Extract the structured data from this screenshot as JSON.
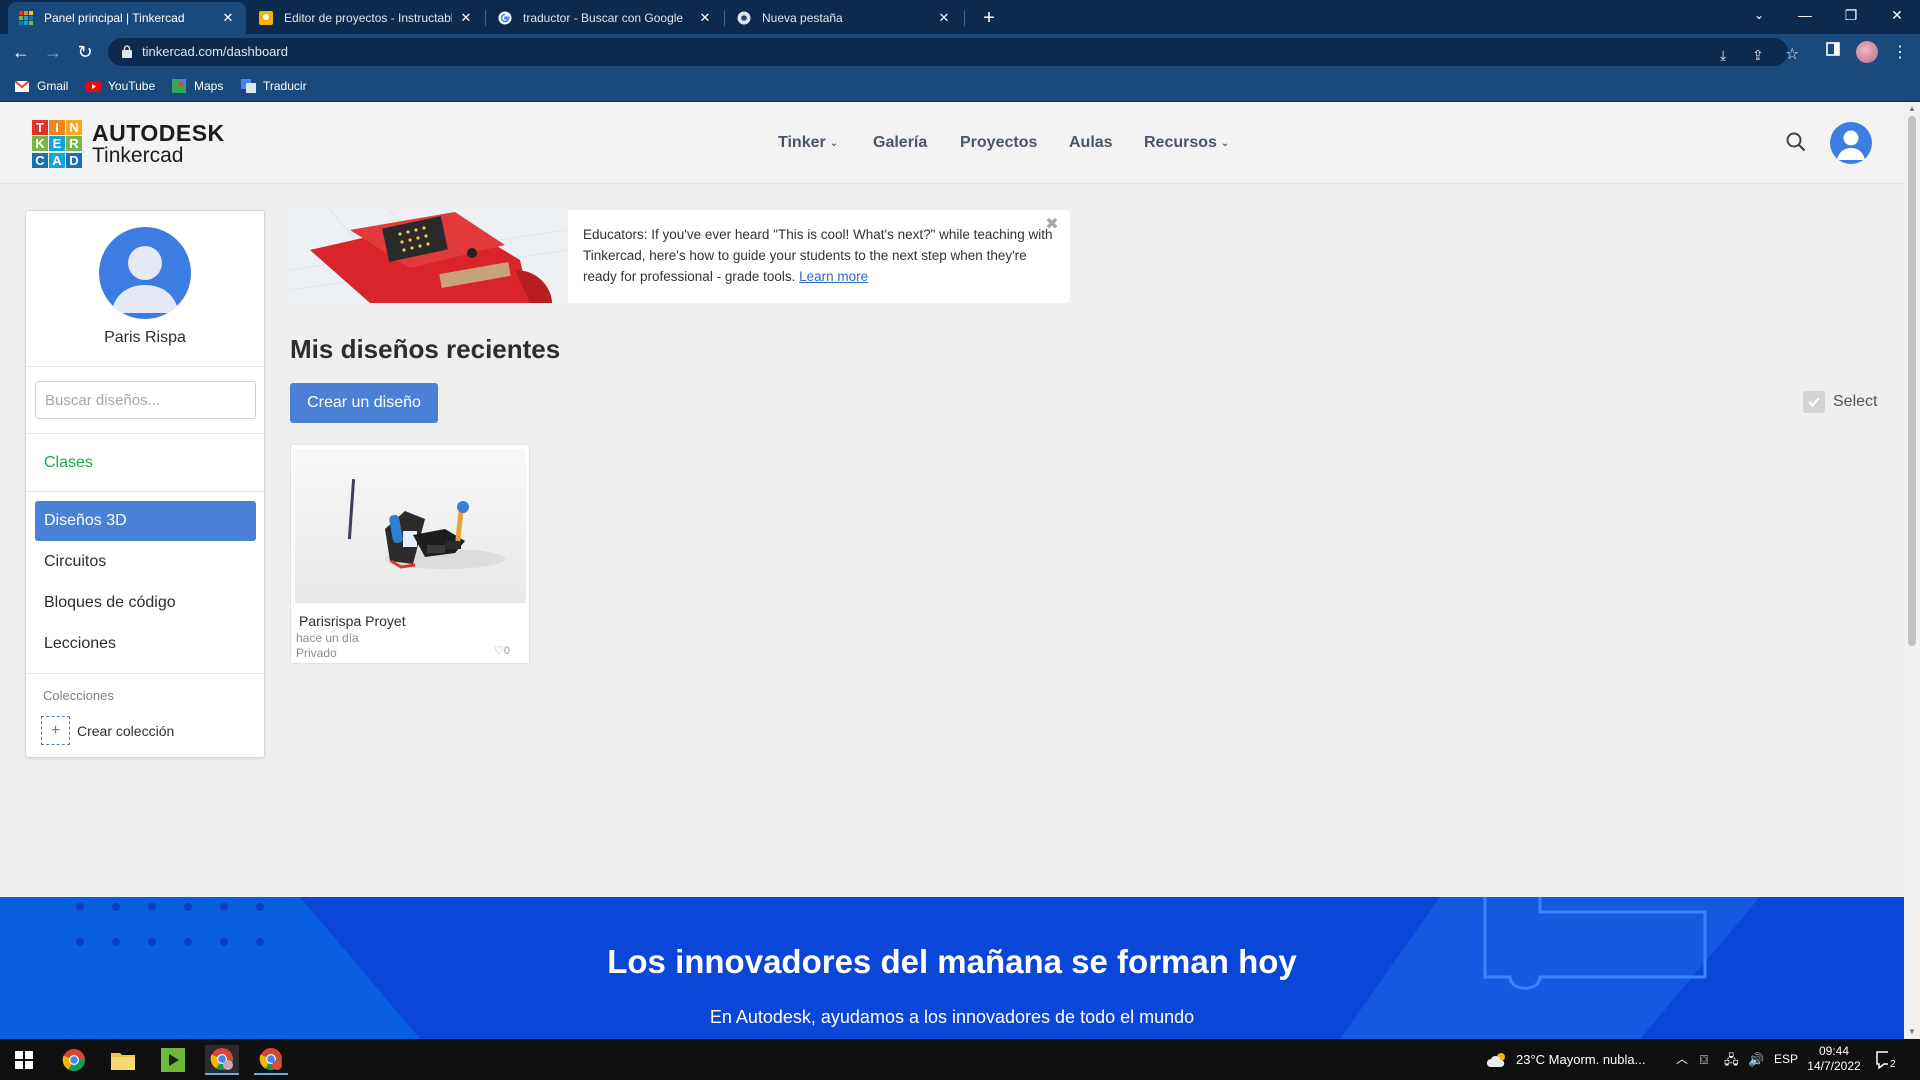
{
  "browser": {
    "tabs": [
      {
        "title": "Panel principal | Tinkercad",
        "active": true,
        "icon": "tinkercad-favicon"
      },
      {
        "title": "Editor de proyectos - Instructables",
        "active": false,
        "icon": "instructables-favicon"
      },
      {
        "title": "traductor - Buscar con Google",
        "active": false,
        "icon": "google-favicon"
      },
      {
        "title": "Nueva pestaña",
        "active": false,
        "icon": "chrome-favicon"
      }
    ],
    "url": "tinkercad.com/dashboard",
    "bookmarks": [
      {
        "label": "Gmail",
        "icon": "gmail-icon"
      },
      {
        "label": "YouTube",
        "icon": "youtube-icon"
      },
      {
        "label": "Maps",
        "icon": "maps-icon"
      },
      {
        "label": "Traducir",
        "icon": "translate-icon"
      }
    ]
  },
  "header": {
    "brand_line1": "AUTODESK",
    "brand_line2": "Tinkercad",
    "logo_letters": [
      "T",
      "I",
      "N",
      "K",
      "E",
      "R",
      "C",
      "A",
      "D"
    ],
    "nav": [
      {
        "label": "Tinker",
        "dropdown": true
      },
      {
        "label": "Galería",
        "dropdown": false
      },
      {
        "label": "Proyectos",
        "dropdown": false
      },
      {
        "label": "Aulas",
        "dropdown": false
      },
      {
        "label": "Recursos",
        "dropdown": true
      }
    ]
  },
  "sidebar": {
    "user_name": "Paris Rispa",
    "search_placeholder": "Buscar diseños...",
    "classes_label": "Clases",
    "items": [
      {
        "label": "Diseños 3D",
        "active": true
      },
      {
        "label": "Circuitos",
        "active": false
      },
      {
        "label": "Bloques de código",
        "active": false
      },
      {
        "label": "Lecciones",
        "active": false
      }
    ],
    "collections_label": "Colecciones",
    "create_collection_label": "Crear colección"
  },
  "banner": {
    "text": "Educators: If you've ever heard \"This is cool! What's next?\" while teaching with Tinkercad, here's how to guide your students to the next step when they're ready for professional - grade tools.",
    "link_label": "Learn more"
  },
  "main": {
    "section_title": "Mis diseños recientes",
    "create_button": "Crear un diseño",
    "select_label": "Select",
    "designs": [
      {
        "title": "Parisrispa Proyet",
        "updated": "hace un día",
        "visibility": "Privado",
        "likes": "0"
      }
    ]
  },
  "footer": {
    "title": "Los innovadores del mañana se forman hoy",
    "subtitle": "En Autodesk, ayudamos a los innovadores de todo el mundo"
  },
  "taskbar": {
    "weather": "23°C  Mayorm. nubla...",
    "language": "ESP",
    "time": "09:44",
    "date": "14/7/2022",
    "notifications": "2"
  },
  "colors": {
    "accent": "#4a80d6",
    "classes_green": "#1aa84f",
    "footer_blue": "#0a5fe0",
    "chrome_dark": "#0c2a4e",
    "chrome_mid": "#1a4a7c"
  }
}
